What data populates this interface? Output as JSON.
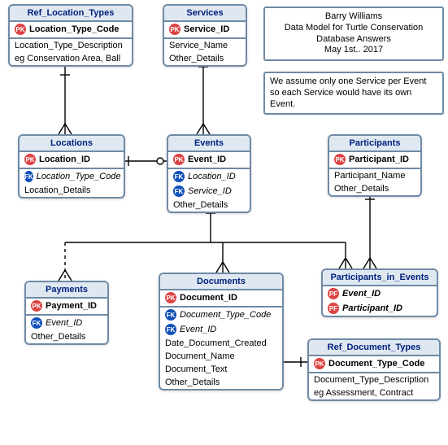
{
  "notes": {
    "top": {
      "l1": "Barry Williams",
      "l2": "Data Model for Turtle Conservation",
      "l3": "Database Answers",
      "l4": "May 1st.. 2017"
    },
    "assume": {
      "l1": "We assume only one Service per Event",
      "l2": "so each Service would have its own Event."
    }
  },
  "entities": {
    "ref_location_types": {
      "title": "Ref_Location_Types",
      "pk": "Location_Type_Code",
      "a1": "Location_Type_Description",
      "a2": "eg Conservation Area, Ball"
    },
    "services": {
      "title": "Services",
      "pk": "Service_ID",
      "a1": "Service_Name",
      "a2": "Other_Details"
    },
    "locations": {
      "title": "Locations",
      "pk": "Location_ID",
      "fk": "Location_Type_Code",
      "a1": "Location_Details"
    },
    "events": {
      "title": "Events",
      "pk": "Event_ID",
      "fk1": "Location_ID",
      "fk2": "Service_ID",
      "a1": "Other_Details"
    },
    "participants": {
      "title": "Participants",
      "pk": "Participant_ID",
      "a1": "Participant_Name",
      "a2": "Other_Details"
    },
    "payments": {
      "title": "Payments",
      "pk": "Payment_ID",
      "fk": "Event_ID",
      "a1": "Other_Details"
    },
    "documents": {
      "title": "Documents",
      "pk": "Document_ID",
      "fk1": "Document_Type_Code",
      "fk2": "Event_ID",
      "a1": "Date_Document_Created",
      "a2": "Document_Name",
      "a3": "Document_Text",
      "a4": "Other_Details"
    },
    "pie": {
      "title": "Participants_in_Events",
      "k1": "Event_ID",
      "k2": "Participant_ID"
    },
    "ref_doc_types": {
      "title": "Ref_Document_Types",
      "pk": "Document_Type_Code",
      "a1": "Document_Type_Description",
      "a2": "eg Assessment, Contract"
    }
  },
  "relationships": [
    {
      "from": "Ref_Location_Types",
      "to": "Locations",
      "type": "one-to-many"
    },
    {
      "from": "Locations",
      "to": "Events",
      "type": "one-to-many-optional"
    },
    {
      "from": "Services",
      "to": "Events",
      "type": "one-to-many"
    },
    {
      "from": "Events",
      "to": "Payments",
      "type": "one-to-many",
      "dashed": true
    },
    {
      "from": "Events",
      "to": "Documents",
      "type": "one-to-many"
    },
    {
      "from": "Events",
      "to": "Participants_in_Events",
      "type": "one-to-many"
    },
    {
      "from": "Participants",
      "to": "Participants_in_Events",
      "type": "one-to-many"
    },
    {
      "from": "Ref_Document_Types",
      "to": "Documents",
      "type": "one-to-many"
    }
  ]
}
